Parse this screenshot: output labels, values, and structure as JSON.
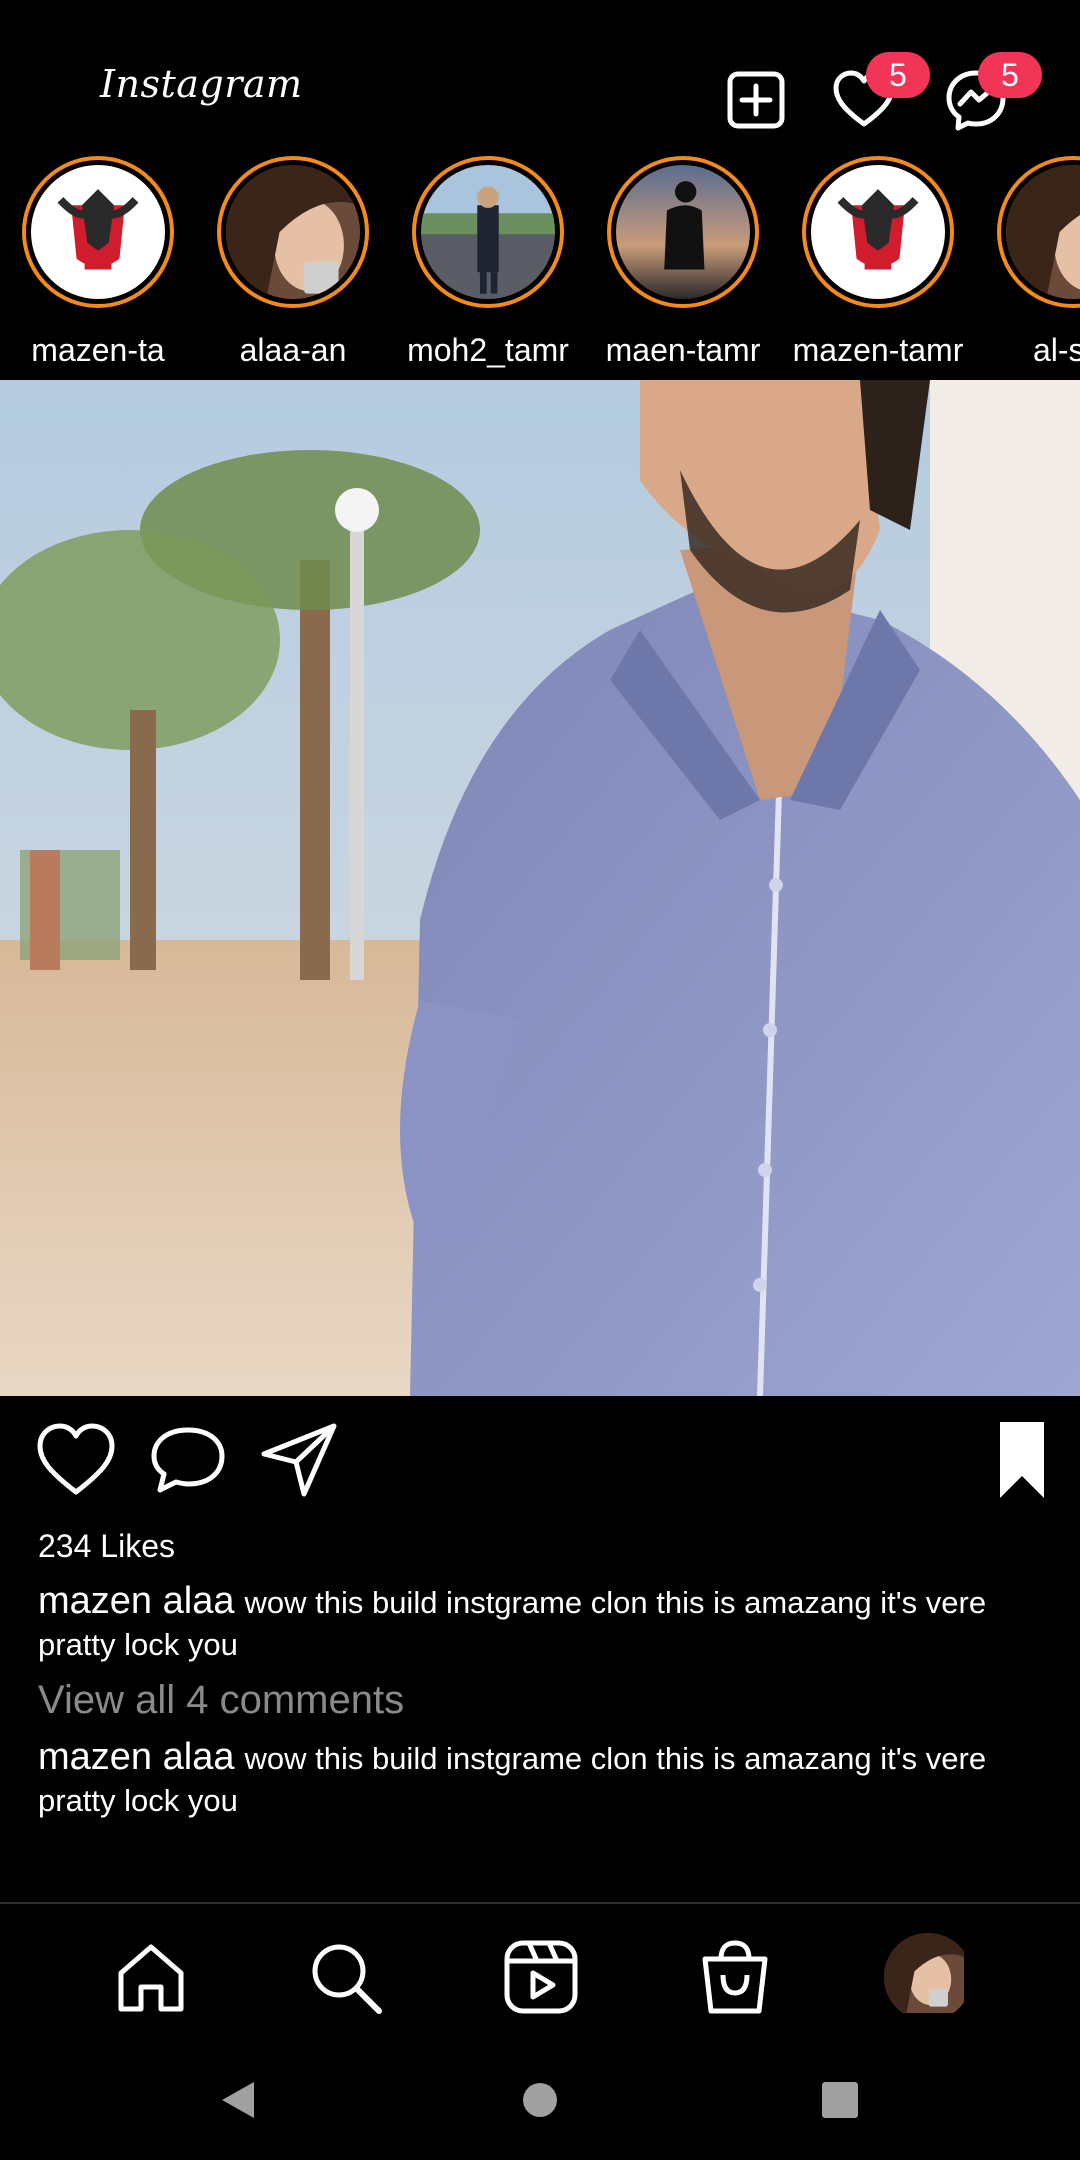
{
  "header": {
    "logo_text": "Instagram",
    "notifications_count": "5",
    "messages_count": "5",
    "icons": [
      "add-post-icon",
      "heart-icon",
      "messenger-icon"
    ],
    "badge_color": "#f23456"
  },
  "stories": [
    {
      "name": "mazen-ta",
      "avatar": "emblem"
    },
    {
      "name": "alaa-an",
      "avatar": "portrait-woman"
    },
    {
      "name": "moh2_tamr",
      "avatar": "man-in-suit"
    },
    {
      "name": "maen-tamr",
      "avatar": "silhouette-sunset"
    },
    {
      "name": "mazen-tamr",
      "avatar": "emblem"
    },
    {
      "name": "al-sar",
      "avatar": "portrait-woman"
    }
  ],
  "story_ring_color": "#f28a1c",
  "post": {
    "likes": "234 Likes",
    "caption_user": "mazen alaa",
    "caption_text": "wow this build instgrame clon this is amazang it's vere pratty lock you",
    "view_comments": "View all 4 comments",
    "comment_user": "mazen alaa",
    "comment_text": "wow this build instgrame clon this is amazang it's vere pratty lock you"
  },
  "post_actions": [
    "like-icon",
    "comment-icon",
    "share-icon",
    "bookmark-icon"
  ],
  "bottom_nav": [
    "home-icon",
    "search-icon",
    "reels-icon",
    "shop-icon",
    "profile-avatar"
  ],
  "system_nav": [
    "back-icon",
    "home-circle-icon",
    "recents-icon"
  ]
}
